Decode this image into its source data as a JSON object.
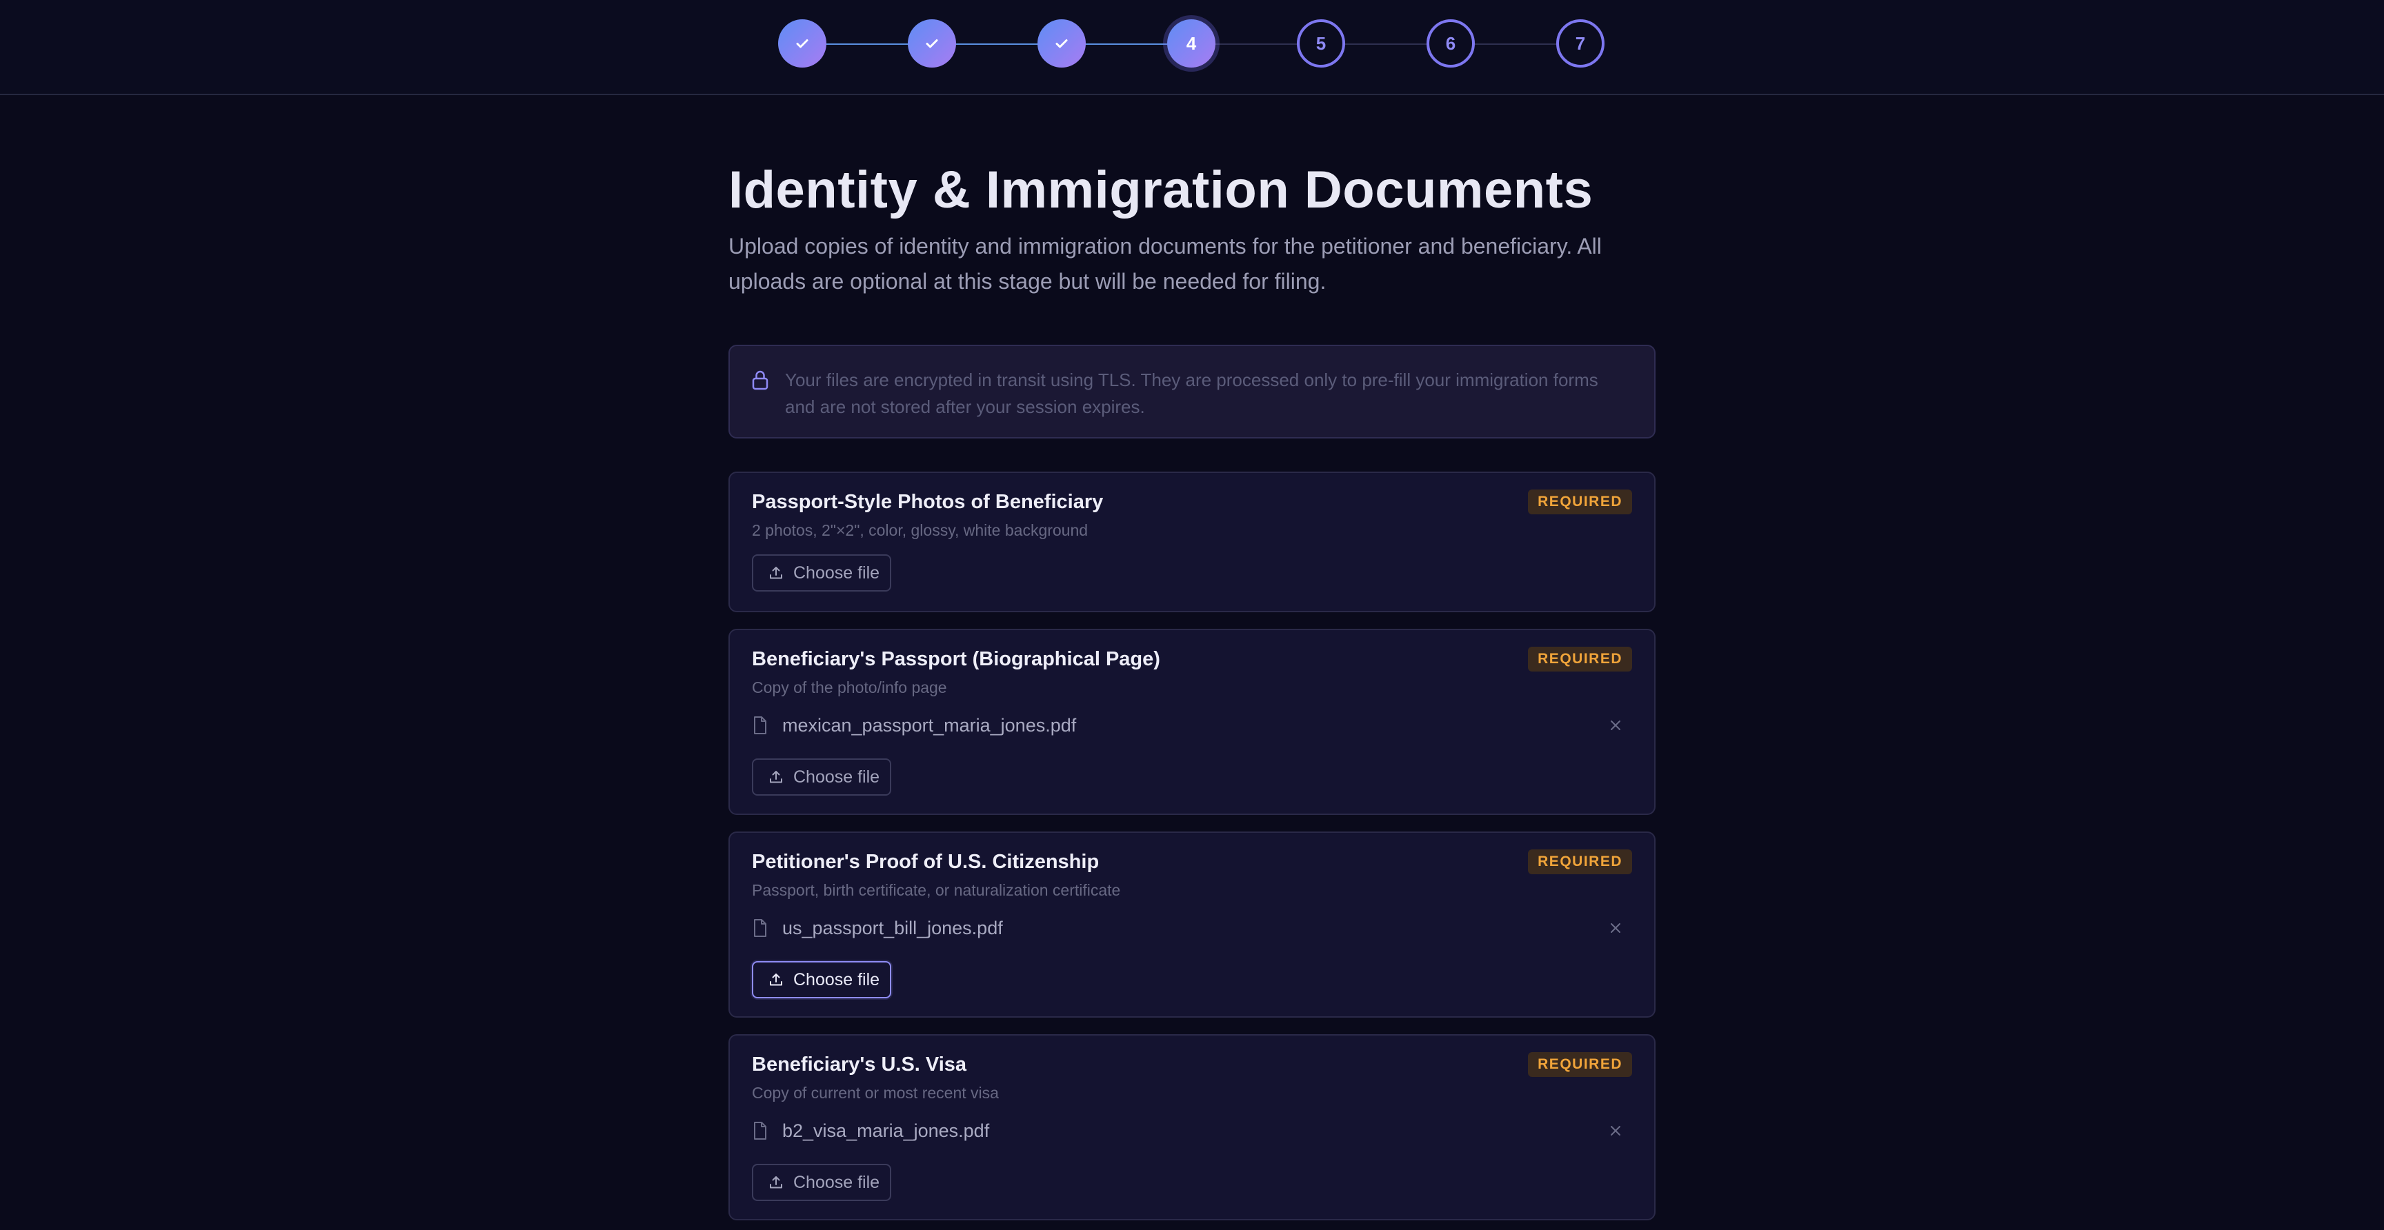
{
  "stepper": {
    "steps": [
      {
        "label": "",
        "state": "done"
      },
      {
        "label": "",
        "state": "done"
      },
      {
        "label": "",
        "state": "done"
      },
      {
        "label": "4",
        "state": "current"
      },
      {
        "label": "5",
        "state": "pending"
      },
      {
        "label": "6",
        "state": "pending"
      },
      {
        "label": "7",
        "state": "pending"
      }
    ],
    "done_icon": "check-icon"
  },
  "page": {
    "title": "Identity & Immigration Documents",
    "subtitle": "Upload copies of identity and immigration documents for the petitioner and beneficiary. All uploads are optional at this stage but will be needed for filing."
  },
  "notice": {
    "icon": "lock-icon",
    "text": "Your files are encrypted in transit using TLS. They are processed only to pre-fill your immigration forms and are not stored after your session expires."
  },
  "documents": [
    {
      "title": "Passport-Style Photos of Beneficiary",
      "description": "2 photos, 2\"×2\", color, glossy, white background",
      "badge": "REQUIRED",
      "file": null,
      "choose_label": "Choose file"
    },
    {
      "title": "Beneficiary's Passport (Biographical Page)",
      "description": "Copy of the photo/info page",
      "badge": "REQUIRED",
      "file": "mexican_passport_maria_jones.pdf",
      "choose_label": "Choose file"
    },
    {
      "title": "Petitioner's Proof of U.S. Citizenship",
      "description": "Passport, birth certificate, or naturalization certificate",
      "badge": "REQUIRED",
      "file": "us_passport_bill_jones.pdf",
      "choose_label": "Choose file"
    },
    {
      "title": "Beneficiary's U.S. Visa",
      "description": "Copy of current or most recent visa",
      "badge": "REQUIRED",
      "file": "b2_visa_maria_jones.pdf",
      "choose_label": "Choose file"
    }
  ],
  "colors": {
    "background": "#0a0a1b",
    "accent": "#8f8af5",
    "badge_text": "#f0a43a"
  }
}
